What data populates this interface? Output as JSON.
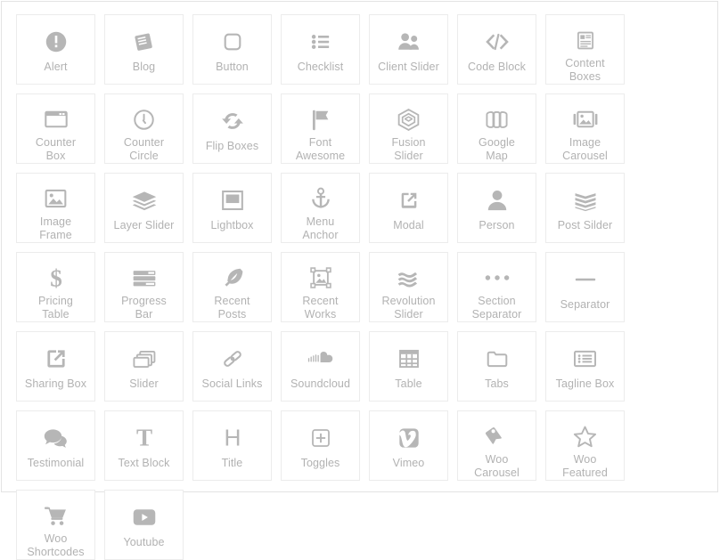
{
  "panel": {
    "name": "fusion-builder-shortcode-picker",
    "border_color": "#e3e3e3",
    "card_border_color": "#ececec",
    "icon_color": "#b6b6b6",
    "label_color": "#b2b2b2",
    "background": "#ffffff",
    "columns": 8,
    "rows": 6,
    "item_count": 44
  },
  "elements": [
    {
      "label": "Alert",
      "icon": "alert-circle-icon"
    },
    {
      "label": "Blog",
      "icon": "book-icon"
    },
    {
      "label": "Button",
      "icon": "rounded-square-icon"
    },
    {
      "label": "Checklist",
      "icon": "list-ul-icon"
    },
    {
      "label": "Client Slider",
      "icon": "users-icon"
    },
    {
      "label": "Code Block",
      "icon": "code-icon"
    },
    {
      "label": "Content\nBoxes",
      "icon": "content-box-icon"
    },
    {
      "label": "Counter\nBox",
      "icon": "window-icon"
    },
    {
      "label": "Counter\nCircle",
      "icon": "clock-icon"
    },
    {
      "label": "Flip Boxes",
      "icon": "refresh-cycle-icon"
    },
    {
      "label": "Font\nAwesome",
      "icon": "flag-icon"
    },
    {
      "label": "Fusion\nSlider",
      "icon": "hexagon-layers-icon"
    },
    {
      "label": "Google\nMap",
      "icon": "map-icon"
    },
    {
      "label": "Image\nCarousel",
      "icon": "image-carousel-icon"
    },
    {
      "label": "Image\nFrame",
      "icon": "picture-icon"
    },
    {
      "label": "Layer Slider",
      "icon": "layers-icon"
    },
    {
      "label": "Lightbox",
      "icon": "lightbox-icon"
    },
    {
      "label": "Menu\nAnchor",
      "icon": "anchor-icon"
    },
    {
      "label": "Modal",
      "icon": "external-link-square-icon"
    },
    {
      "label": "Person",
      "icon": "user-icon"
    },
    {
      "label": "Post Silder",
      "icon": "chevron-stack-icon"
    },
    {
      "label": "Pricing\nTable",
      "icon": "dollar-icon"
    },
    {
      "label": "Progress\nBar",
      "icon": "progress-bars-icon"
    },
    {
      "label": "Recent\nPosts",
      "icon": "feather-icon"
    },
    {
      "label": "Recent\nWorks",
      "icon": "crop-image-icon"
    },
    {
      "label": "Revolution\nSlider",
      "icon": "waves-icon"
    },
    {
      "label": "Section\nSeparator",
      "icon": "ellipsis-icon"
    },
    {
      "label": "Separator",
      "icon": "minus-icon"
    },
    {
      "label": "Sharing Box",
      "icon": "external-link-icon"
    },
    {
      "label": "Slider",
      "icon": "stacked-windows-icon"
    },
    {
      "label": "Social Links",
      "icon": "chain-link-icon"
    },
    {
      "label": "Soundcloud",
      "icon": "soundcloud-icon"
    },
    {
      "label": "Table",
      "icon": "table-grid-icon"
    },
    {
      "label": "Tabs",
      "icon": "folder-icon"
    },
    {
      "label": "Tagline Box",
      "icon": "tagline-list-icon"
    },
    {
      "label": "Testimonial",
      "icon": "comments-icon"
    },
    {
      "label": "Text Block",
      "icon": "text-t-icon"
    },
    {
      "label": "Title",
      "icon": "heading-h-icon"
    },
    {
      "label": "Toggles",
      "icon": "plus-square-icon"
    },
    {
      "label": "Vimeo",
      "icon": "vimeo-icon"
    },
    {
      "label": "Woo\nCarousel",
      "icon": "price-tag-icon"
    },
    {
      "label": "Woo\nFeatured",
      "icon": "star-outline-icon"
    },
    {
      "label": "Woo\nShortcodes",
      "icon": "shopping-cart-icon"
    },
    {
      "label": "Youtube",
      "icon": "youtube-play-icon"
    }
  ]
}
